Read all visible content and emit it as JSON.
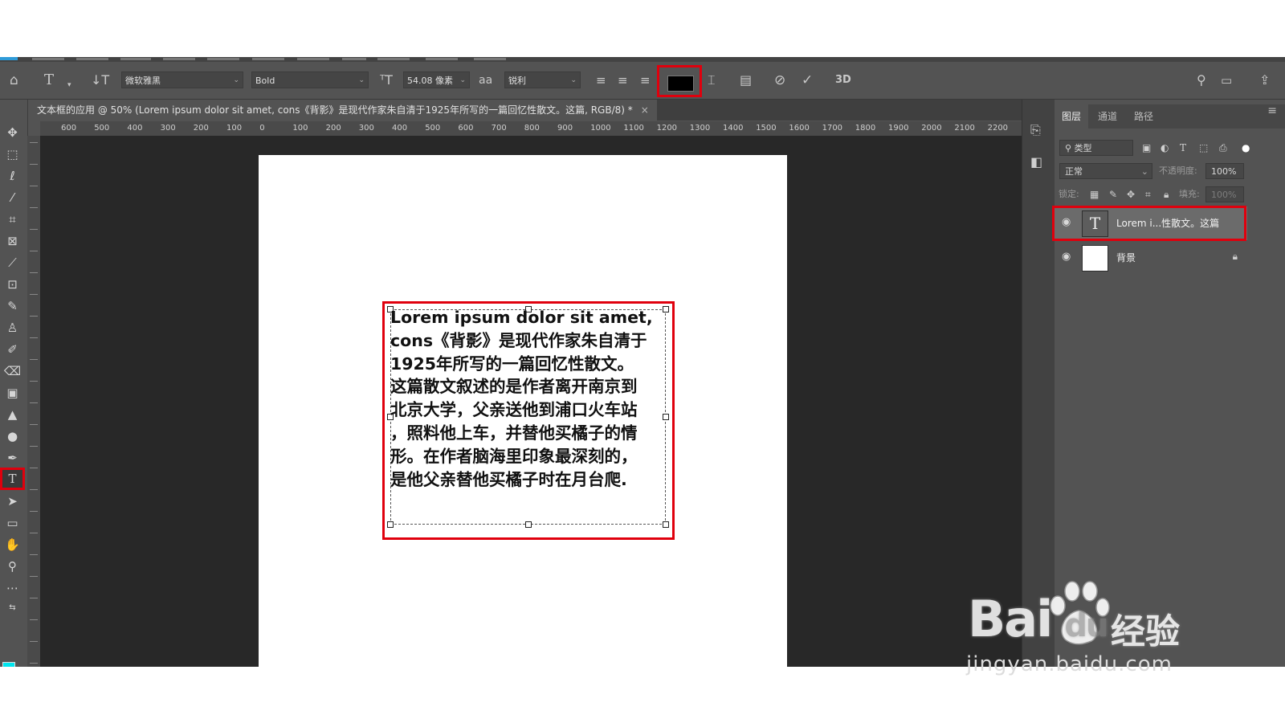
{
  "options_bar": {
    "font_family": "微软雅黑",
    "font_style": "Bold",
    "font_size": "54.08 像素",
    "antialias_icon_label": "aa",
    "antialias": "锐利",
    "text_color": "#000000",
    "three_d_label": "3D"
  },
  "document_tab": {
    "title": "文本框的应用 @ 50% (Lorem ipsum dolor sit amet, cons《背影》是现代作家朱自清于1925年所写的一篇回忆性散文。这篇, RGB/8) *",
    "close": "×"
  },
  "ruler": {
    "ticks": [
      "600",
      "500",
      "400",
      "300",
      "200",
      "100",
      "0",
      "100",
      "200",
      "300",
      "400",
      "500",
      "600",
      "700",
      "800",
      "900",
      "1000",
      "1100",
      "1200",
      "1300",
      "1400",
      "1500",
      "1600",
      "1700",
      "1800",
      "1900",
      "2000",
      "2100",
      "2200"
    ]
  },
  "canvas_text": {
    "lines": [
      "Lorem ipsum dolor sit amet,",
      "cons《背影》是现代作家朱自清于",
      "1925年所写的一篇回忆性散文。",
      "这篇散文叙述的是作者离开南京到",
      "北京大学，父亲送他到浦口火车站",
      "，照料他上车，并替他买橘子的情",
      "形。在作者脑海里印象最深刻的，",
      "是他父亲替他买橘子时在月台爬."
    ]
  },
  "toolbox": {
    "foreground_color": "#00e5ee",
    "background_color": "#ffffff"
  },
  "layers_panel": {
    "tabs": [
      "图层",
      "通道",
      "路径"
    ],
    "filter_placeholder": "类型",
    "blend_mode": "正常",
    "opacity_label": "不透明度:",
    "opacity_value": "100%",
    "lock_label": "锁定:",
    "fill_label": "填充:",
    "fill_value": "100%",
    "layers": [
      {
        "name": "Lorem i...性散文。这篇",
        "thumb": "T",
        "selected": true
      },
      {
        "name": "背景",
        "thumb": "",
        "locked": true
      }
    ]
  },
  "watermark": {
    "brand": "Bai",
    "brand_suffix": "du",
    "chinese": "经验",
    "url": "jingyan.baidu.com"
  },
  "highlight_color": "#e0000d"
}
